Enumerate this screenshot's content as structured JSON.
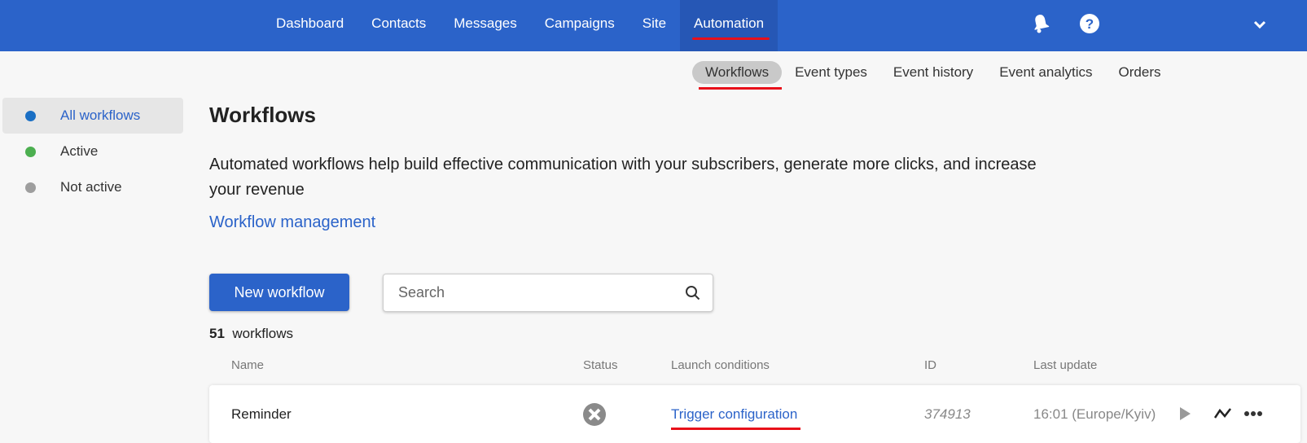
{
  "nav": {
    "items": [
      "Dashboard",
      "Contacts",
      "Messages",
      "Campaigns",
      "Site",
      "Automation"
    ],
    "active": "Automation"
  },
  "subnav": {
    "items": [
      "Workflows",
      "Event types",
      "Event history",
      "Event analytics",
      "Orders"
    ],
    "active": "Workflows"
  },
  "sidebar": {
    "items": [
      {
        "label": "All workflows",
        "color": "#1a6fc4"
      },
      {
        "label": "Active",
        "color": "#4caf50"
      },
      {
        "label": "Not active",
        "color": "#9e9e9e"
      }
    ]
  },
  "page": {
    "title": "Workflows",
    "description": "Automated workflows help build effective communication with your subscribers, generate more clicks, and increase your revenue",
    "link": "Workflow management",
    "new_button": "New workflow",
    "search_placeholder": "Search",
    "count": "51",
    "count_label": "workflows"
  },
  "table": {
    "headers": [
      "Name",
      "Status",
      "Launch conditions",
      "ID",
      "Last update"
    ],
    "rows": [
      {
        "name": "Reminder",
        "status": "not-active-icon",
        "launch": "Trigger configuration",
        "id": "374913",
        "updated": "16:01 (Europe/Kyiv)"
      }
    ]
  }
}
